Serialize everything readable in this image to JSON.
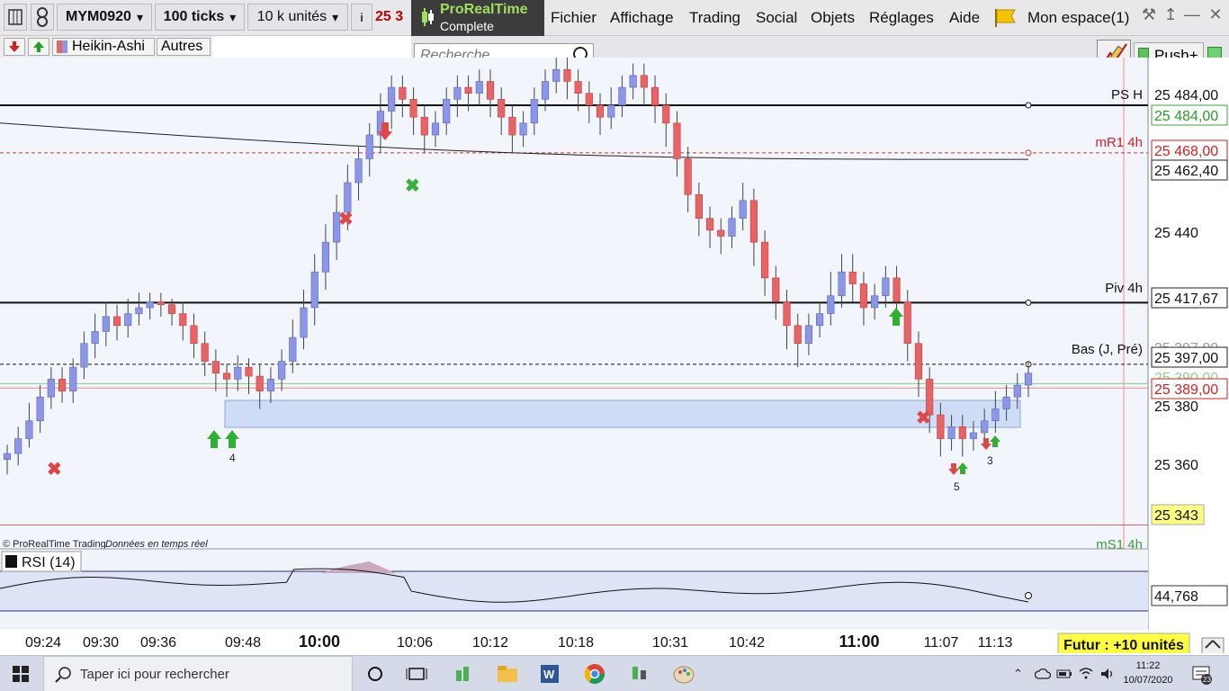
{
  "toolbar": {
    "symbol": "MYM0920",
    "interval": "100 ticks",
    "units": "10 k unités",
    "price_partial": "25 3"
  },
  "brand": {
    "name": "ProRealTime",
    "edition": "Complete"
  },
  "menu": [
    "Fichier",
    "Affichage",
    "Trading",
    "Social",
    "Objets",
    "Réglages",
    "Aide"
  ],
  "account": "Mon espace(1)",
  "row2": {
    "chart_type": "Heikin-Ashi",
    "others": "Autres"
  },
  "search": {
    "placeholder": "Recherche ..."
  },
  "push_label": "Push+",
  "copyright": "© ProRealTime Trading",
  "realtime": "Données en temps réel",
  "rsi_label": "RSI (14)",
  "rsi_value": "44,768",
  "futur_label": "Futur : +10 unités",
  "colors": {
    "bull": "#8c96e6",
    "bear": "#e86464",
    "grid_bg": "#f1f3fb",
    "zone": "#cfdcf6",
    "accent_green": "#44aa44"
  },
  "chart_data": {
    "type": "candlestick",
    "ylim": [
      25335,
      25500
    ],
    "x_ticks": [
      "09:24",
      "09:30",
      "09:36",
      "09:48",
      "10:00",
      "10:06",
      "10:12",
      "10:18",
      "10:31",
      "10:42",
      "11:00",
      "11:07",
      "11:13"
    ],
    "price_labels": [
      "25 484,00",
      "25 484,00",
      "25 468,00",
      "25 462,40",
      "25 440",
      "25 417,67",
      "25 397,00",
      "25 397,00",
      "25 390,00",
      "25 389,00",
      "25 380",
      "25 360",
      "25 343"
    ],
    "line_labels": [
      "PS H",
      "mR1 4h",
      "Piv 4h",
      "Bas (J, Pré)",
      "mS1 4h"
    ],
    "hlines": [
      {
        "label": "PS H",
        "value": 25484.0
      },
      {
        "label": "mR1 4h",
        "value": 25468.0
      },
      {
        "label": "Piv 4h",
        "value": 25417.67
      },
      {
        "label": "Bas (J, Pré)",
        "value": 25397.0
      },
      {
        "label": "mS1 4h",
        "value": 25343.0
      }
    ],
    "ma_end_value": 25462.4,
    "signal_counts": [
      "4",
      "5",
      "3"
    ],
    "candles": [
      [
        25365,
        25367,
        25360,
        25370
      ],
      [
        25367,
        25372,
        25363,
        25376
      ],
      [
        25372,
        25378,
        25369,
        25384
      ],
      [
        25378,
        25386,
        25374,
        25390
      ],
      [
        25386,
        25392,
        25382,
        25396
      ],
      [
        25392,
        25388,
        25384,
        25396
      ],
      [
        25388,
        25396,
        25384,
        25399
      ],
      [
        25396,
        25404,
        25392,
        25408
      ],
      [
        25404,
        25408,
        25399,
        25414
      ],
      [
        25408,
        25413,
        25403,
        25418
      ],
      [
        25413,
        25410,
        25405,
        25417
      ],
      [
        25410,
        25414,
        25406,
        25419
      ],
      [
        25414,
        25416,
        25410,
        25421
      ],
      [
        25416,
        25418,
        25412,
        25421
      ],
      [
        25418,
        25417,
        25413,
        25421
      ],
      [
        25417,
        25414,
        25410,
        25419
      ],
      [
        25414,
        25410,
        25405,
        25418
      ],
      [
        25410,
        25404,
        25399,
        25414
      ],
      [
        25404,
        25398,
        25393,
        25408
      ],
      [
        25398,
        25394,
        25388,
        25402
      ],
      [
        25394,
        25392,
        25386,
        25397
      ],
      [
        25392,
        25396,
        25388,
        25400
      ],
      [
        25396,
        25393,
        25387,
        25399
      ],
      [
        25393,
        25388,
        25382,
        25397
      ],
      [
        25388,
        25392,
        25384,
        25396
      ],
      [
        25392,
        25398,
        25388,
        25402
      ],
      [
        25398,
        25406,
        25394,
        25412
      ],
      [
        25406,
        25416,
        25402,
        25422
      ],
      [
        25416,
        25428,
        25410,
        25434
      ],
      [
        25428,
        25438,
        25422,
        25444
      ],
      [
        25438,
        25448,
        25432,
        25454
      ],
      [
        25448,
        25458,
        25442,
        25464
      ],
      [
        25458,
        25466,
        25452,
        25470
      ],
      [
        25466,
        25474,
        25460,
        25478
      ],
      [
        25474,
        25482,
        25468,
        25488
      ],
      [
        25482,
        25490,
        25476,
        25494
      ],
      [
        25490,
        25486,
        25480,
        25494
      ],
      [
        25486,
        25480,
        25474,
        25490
      ],
      [
        25480,
        25474,
        25468,
        25484
      ],
      [
        25474,
        25478,
        25470,
        25482
      ],
      [
        25478,
        25486,
        25474,
        25490
      ],
      [
        25486,
        25490,
        25480,
        25494
      ],
      [
        25490,
        25488,
        25482,
        25494
      ],
      [
        25488,
        25492,
        25484,
        25496
      ],
      [
        25492,
        25486,
        25480,
        25496
      ],
      [
        25486,
        25480,
        25474,
        25490
      ],
      [
        25480,
        25474,
        25468,
        25484
      ],
      [
        25474,
        25478,
        25470,
        25482
      ],
      [
        25478,
        25486,
        25474,
        25490
      ],
      [
        25486,
        25492,
        25482,
        25496
      ],
      [
        25492,
        25496,
        25488,
        25500
      ],
      [
        25496,
        25492,
        25486,
        25500
      ],
      [
        25492,
        25488,
        25482,
        25496
      ],
      [
        25488,
        25484,
        25478,
        25492
      ],
      [
        25484,
        25480,
        25474,
        25488
      ],
      [
        25480,
        25484,
        25476,
        25490
      ],
      [
        25484,
        25490,
        25480,
        25494
      ],
      [
        25490,
        25494,
        25486,
        25498
      ],
      [
        25494,
        25490,
        25484,
        25498
      ],
      [
        25490,
        25484,
        25478,
        25494
      ],
      [
        25484,
        25478,
        25470,
        25488
      ],
      [
        25478,
        25466,
        25460,
        25482
      ],
      [
        25466,
        25454,
        25448,
        25470
      ],
      [
        25454,
        25446,
        25440,
        25458
      ],
      [
        25446,
        25442,
        25436,
        25450
      ],
      [
        25442,
        25440,
        25434,
        25446
      ],
      [
        25440,
        25446,
        25436,
        25450
      ],
      [
        25446,
        25452,
        25442,
        25458
      ],
      [
        25452,
        25438,
        25430,
        25456
      ],
      [
        25438,
        25426,
        25420,
        25442
      ],
      [
        25426,
        25418,
        25412,
        25430
      ],
      [
        25418,
        25410,
        25402,
        25422
      ],
      [
        25410,
        25404,
        25396,
        25414
      ],
      [
        25404,
        25410,
        25400,
        25414
      ],
      [
        25410,
        25414,
        25406,
        25418
      ],
      [
        25414,
        25420,
        25410,
        25428
      ],
      [
        25420,
        25428,
        25416,
        25434
      ],
      [
        25428,
        25424,
        25418,
        25434
      ],
      [
        25424,
        25416,
        25410,
        25428
      ],
      [
        25416,
        25420,
        25412,
        25424
      ],
      [
        25420,
        25426,
        25416,
        25430
      ],
      [
        25426,
        25418,
        25412,
        25430
      ],
      [
        25418,
        25404,
        25398,
        25422
      ],
      [
        25404,
        25392,
        25386,
        25408
      ],
      [
        25392,
        25380,
        25374,
        25396
      ],
      [
        25380,
        25372,
        25366,
        25384
      ],
      [
        25372,
        25376,
        25368,
        25380
      ],
      [
        25376,
        25372,
        25366,
        25380
      ],
      [
        25372,
        25374,
        25368,
        25378
      ],
      [
        25374,
        25378,
        25370,
        25382
      ],
      [
        25378,
        25382,
        25374,
        25388
      ],
      [
        25382,
        25386,
        25378,
        25390
      ],
      [
        25386,
        25390,
        25382,
        25394
      ],
      [
        25390,
        25394,
        25386,
        25398
      ]
    ]
  }
}
